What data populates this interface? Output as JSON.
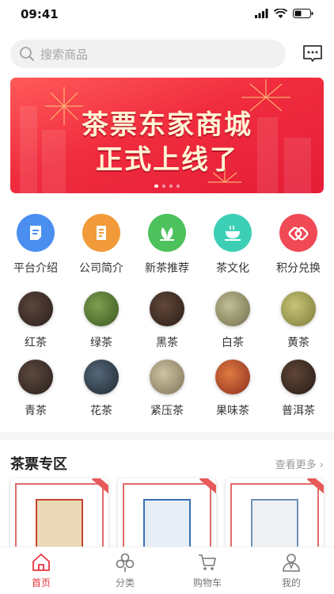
{
  "status": {
    "time": "09:41"
  },
  "search": {
    "placeholder": "搜索商品"
  },
  "banner": {
    "line1": "茶票东家商城",
    "line2": "正式上线了",
    "slide_count": 4,
    "active_slide": 1
  },
  "shortcuts": [
    {
      "label": "平台介绍",
      "color": "#4a8ff0",
      "icon": "document-icon"
    },
    {
      "label": "公司简介",
      "color": "#f29a3a",
      "icon": "file-icon"
    },
    {
      "label": "新茶推荐",
      "color": "#4cc15c",
      "icon": "leaf-icon"
    },
    {
      "label": "茶文化",
      "color": "#3ccfb6",
      "icon": "tea-cup-icon"
    },
    {
      "label": "积分兑换",
      "color": "#f04a56",
      "icon": "exchange-icon"
    }
  ],
  "tea_categories": [
    {
      "label": "红茶",
      "color": "#3a2a24"
    },
    {
      "label": "绿茶",
      "color": "#4d6a2e"
    },
    {
      "label": "黑茶",
      "color": "#3d2a20"
    },
    {
      "label": "白茶",
      "color": "#8d8a62"
    },
    {
      "label": "黄茶",
      "color": "#9a9a4e"
    },
    {
      "label": "青茶",
      "color": "#3a2c26"
    },
    {
      "label": "花茶",
      "color": "#2f3a44"
    },
    {
      "label": "紧压茶",
      "color": "#a89a78"
    },
    {
      "label": "果味茶",
      "color": "#b64a2e"
    },
    {
      "label": "普洱茶",
      "color": "#3a2a22"
    }
  ],
  "section": {
    "title": "茶票专区",
    "more": "查看更多 ›"
  },
  "tickets": [
    {
      "frame_color": "#c7442f",
      "fill": "#e9d9b6"
    },
    {
      "frame_color": "#3a6fb3",
      "fill": "#e8eef6"
    },
    {
      "frame_color": "#6e8fb3",
      "fill": "#eef1f4"
    }
  ],
  "tabs": [
    {
      "label": "首页",
      "active": true,
      "icon": "home-icon"
    },
    {
      "label": "分类",
      "active": false,
      "icon": "category-icon"
    },
    {
      "label": "购物车",
      "active": false,
      "icon": "cart-icon"
    },
    {
      "label": "我的",
      "active": false,
      "icon": "user-icon"
    }
  ],
  "colors": {
    "accent": "#e8343f",
    "banner": "#f02c3e"
  }
}
